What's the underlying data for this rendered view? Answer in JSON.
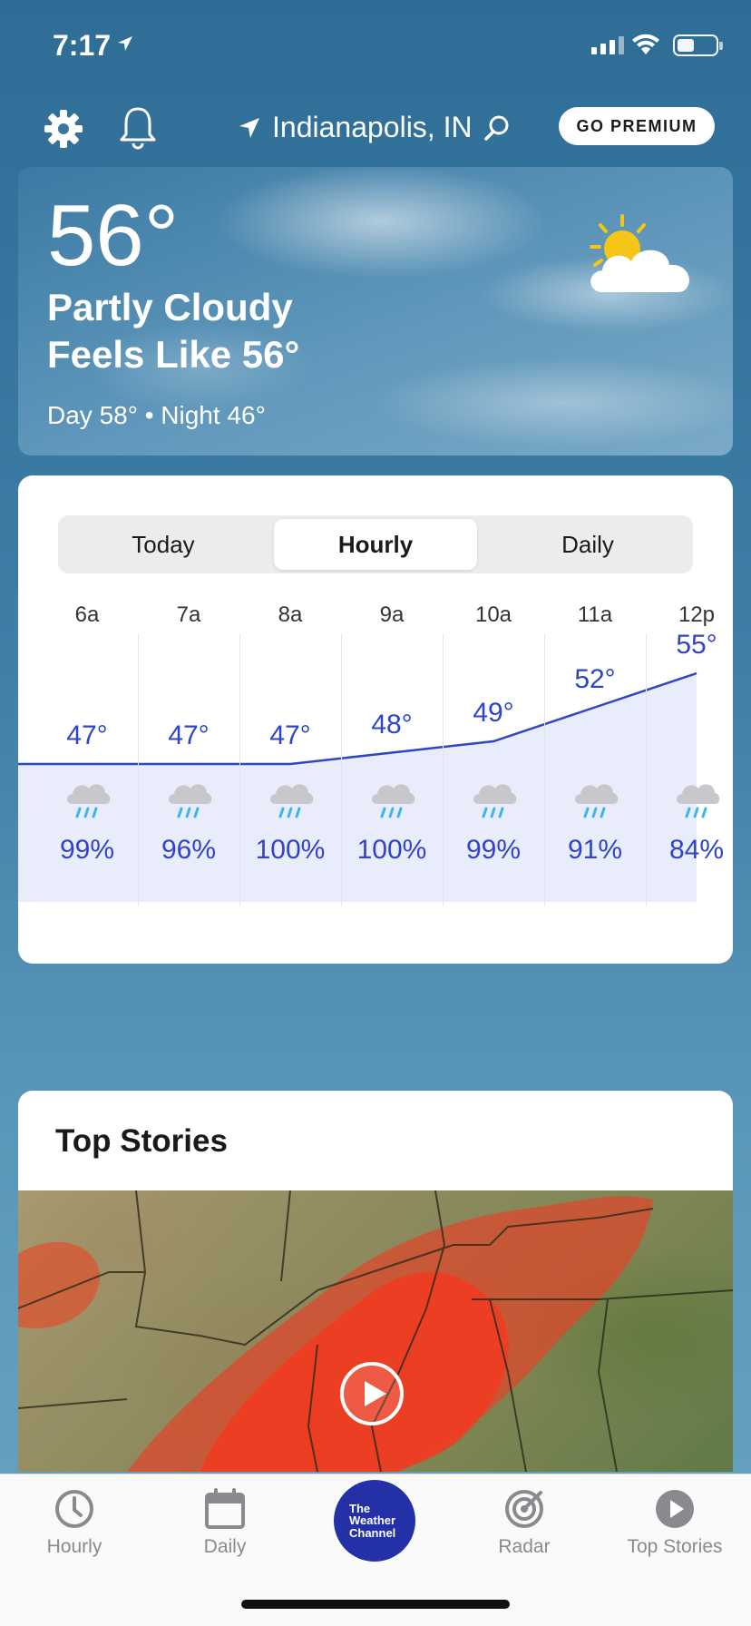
{
  "status_bar": {
    "time": "7:17"
  },
  "header": {
    "location": "Indianapolis, IN",
    "premium_label": "GO PREMIUM"
  },
  "current": {
    "temperature": "56°",
    "condition": "Partly Cloudy",
    "feels_like": "Feels Like 56°",
    "day_night": "Day 58° • Night 46°"
  },
  "forecast": {
    "tabs": [
      {
        "label": "Today",
        "active": false
      },
      {
        "label": "Hourly",
        "active": true
      },
      {
        "label": "Daily",
        "active": false
      }
    ],
    "hours": [
      {
        "time": "6a",
        "temp": "47°",
        "temp_value": 47,
        "precip": "99%"
      },
      {
        "time": "7a",
        "temp": "47°",
        "temp_value": 47,
        "precip": "96%"
      },
      {
        "time": "8a",
        "temp": "47°",
        "temp_value": 47,
        "precip": "100%"
      },
      {
        "time": "9a",
        "temp": "48°",
        "temp_value": 48,
        "precip": "100%"
      },
      {
        "time": "10a",
        "temp": "49°",
        "temp_value": 49,
        "precip": "99%"
      },
      {
        "time": "11a",
        "temp": "52°",
        "temp_value": 52,
        "precip": "91%"
      },
      {
        "time": "12p",
        "temp": "55°",
        "temp_value": 55,
        "precip": "84%"
      }
    ],
    "line_color": "#2e45c9"
  },
  "stories": {
    "title": "Top Stories"
  },
  "tabbar": {
    "items": [
      {
        "label": "Hourly",
        "icon": "clock-icon"
      },
      {
        "label": "Daily",
        "icon": "calendar-icon"
      },
      {
        "label": "Radar",
        "icon": "radar-icon"
      },
      {
        "label": "Top Stories",
        "icon": "play-circle-icon"
      }
    ],
    "logo_lines": [
      "The",
      "Weather",
      "Channel"
    ],
    "logo_color": "#2330a6"
  }
}
